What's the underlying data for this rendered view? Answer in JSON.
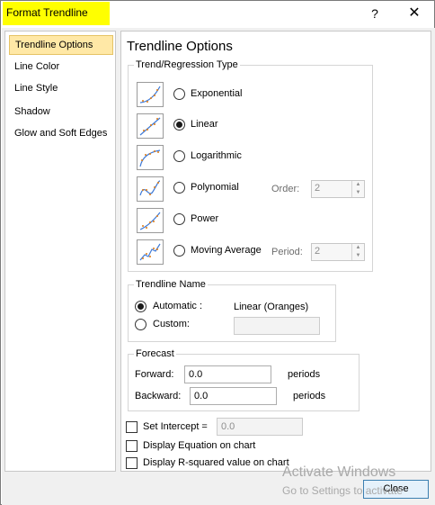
{
  "window": {
    "title": "Format Trendline",
    "help_label": "?",
    "close_label": "✕"
  },
  "nav": {
    "items": [
      {
        "label": "Trendline Options",
        "selected": true
      },
      {
        "label": "Line Color"
      },
      {
        "label": "Line Style"
      },
      {
        "label": "Shadow"
      },
      {
        "label": "Glow and Soft Edges"
      }
    ]
  },
  "panel": {
    "title": "Trendline Options",
    "trend_type": {
      "legend": "Trend/Regression Type",
      "options": [
        {
          "label": "Exponential",
          "icon": "exponential-trend-icon",
          "selected": false
        },
        {
          "label": "Linear",
          "icon": "linear-trend-icon",
          "selected": true
        },
        {
          "label": "Logarithmic",
          "icon": "logarithmic-trend-icon",
          "selected": false
        },
        {
          "label": "Polynomial",
          "icon": "polynomial-trend-icon",
          "selected": false
        },
        {
          "label": "Power",
          "icon": "power-trend-icon",
          "selected": false
        },
        {
          "label": "Moving Average",
          "icon": "moving-average-trend-icon",
          "selected": false
        }
      ],
      "order": {
        "label": "Order:",
        "value": "2"
      },
      "period": {
        "label": "Period:",
        "value": "2"
      }
    },
    "trendline_name": {
      "legend": "Trendline Name",
      "automatic_label": "Automatic :",
      "automatic_value": "Linear (Oranges)",
      "custom_label": "Custom:",
      "custom_value": "",
      "selected": "automatic"
    },
    "forecast": {
      "legend": "Forecast",
      "forward_label": "Forward:",
      "forward_value": "0.0",
      "forward_unit": "periods",
      "backward_label": "Backward:",
      "backward_value": "0.0",
      "backward_unit": "periods"
    },
    "set_intercept": {
      "label": "Set Intercept =",
      "value": "0.0",
      "checked": false
    },
    "display_equation": {
      "label": "Display Equation on chart",
      "checked": false
    },
    "display_rsquared": {
      "label": "Display R-squared value on chart",
      "checked": false
    }
  },
  "footer": {
    "close_label": "Close"
  },
  "watermark": {
    "line1": "Activate Windows",
    "line2": "Go to Settings to activate"
  },
  "colors": {
    "title_highlight": "#ffff00",
    "nav_selected": "#ffe8a6",
    "trend_point": "#e07a10",
    "trend_line": "#3f7ad6"
  }
}
